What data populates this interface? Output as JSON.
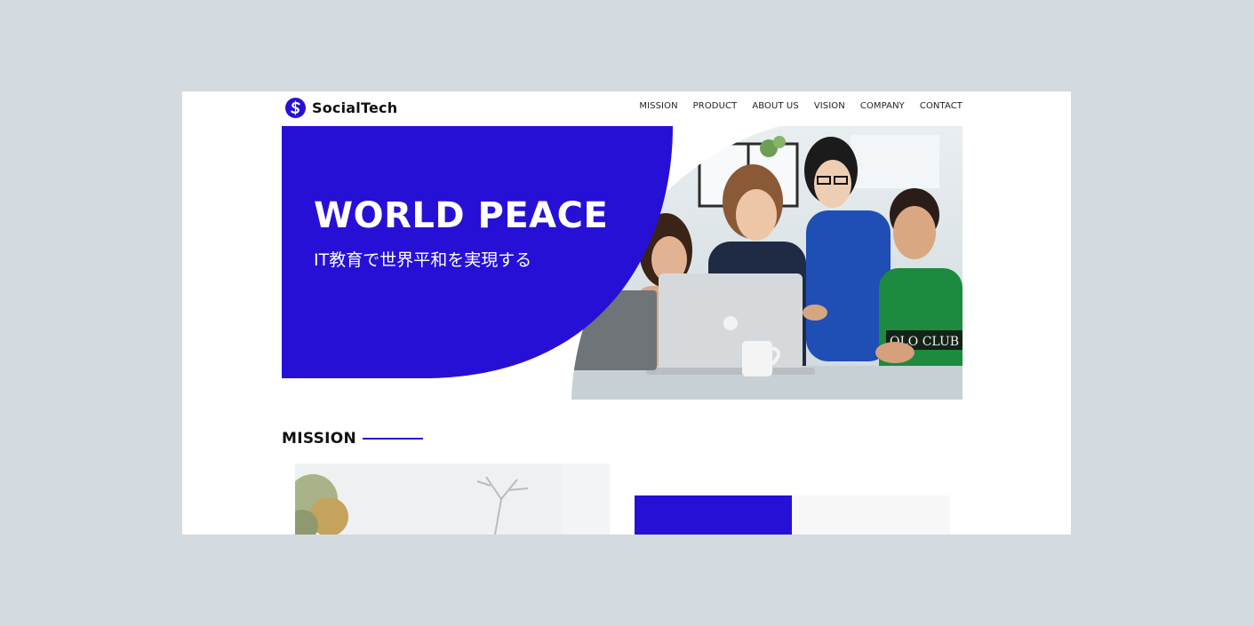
{
  "header": {
    "brand": "SocialTech",
    "nav": [
      "MISSION",
      "PRODUCT",
      "ABOUT US",
      "VISION",
      "COMPANY",
      "CONTACT"
    ]
  },
  "hero": {
    "title": "WORLD PEACE",
    "subtitle": "IT教育で世界平和を実現する",
    "photo": "team-laptop-photo"
  },
  "mission": {
    "heading": "MISSION",
    "photo": "trees-photo"
  },
  "colors": {
    "brand_blue": "#2710d6",
    "page_bg": "#d3dae0",
    "text": "#111111"
  }
}
